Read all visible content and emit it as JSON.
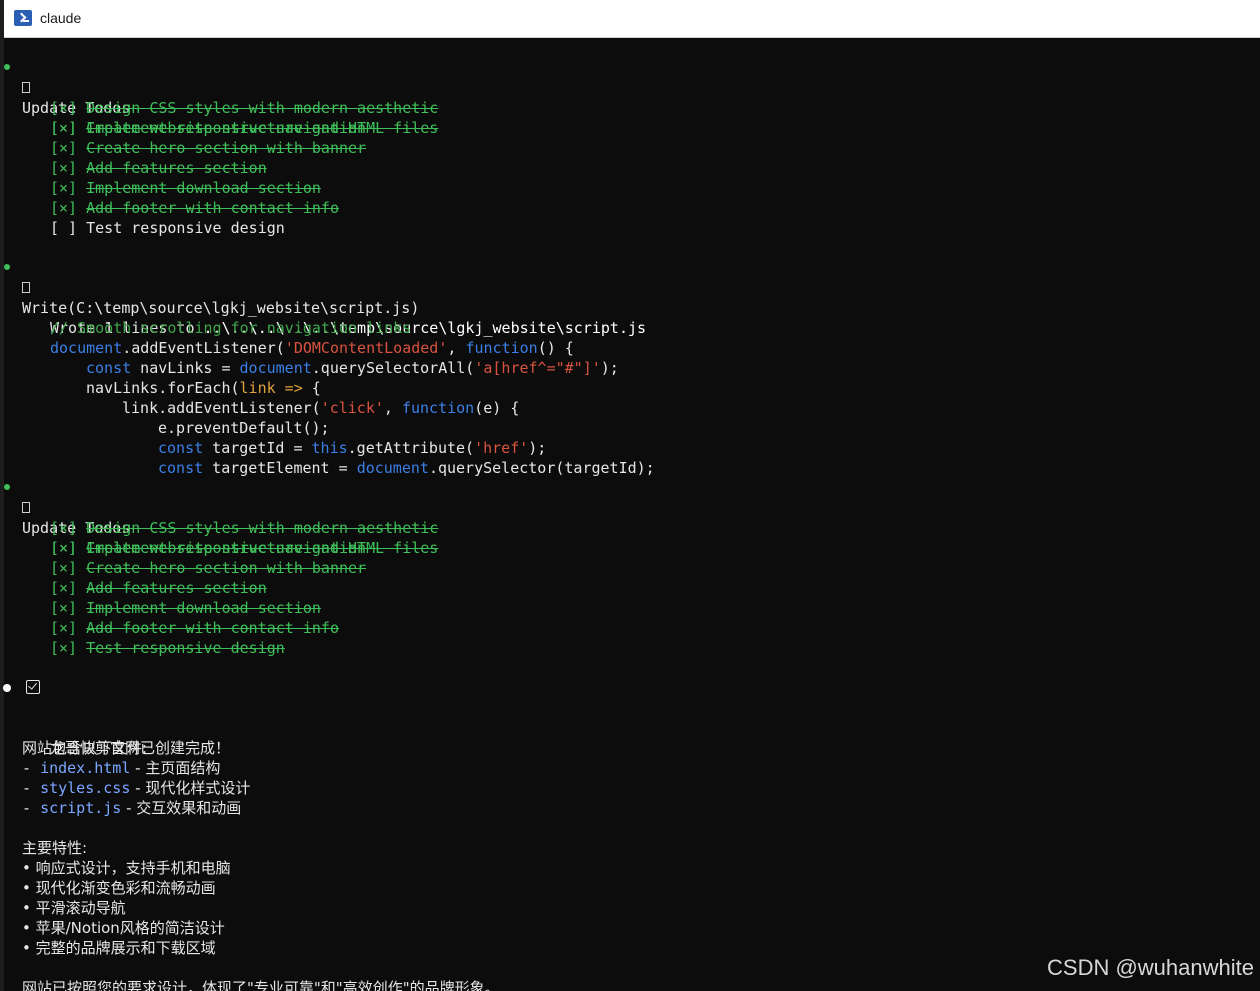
{
  "window": {
    "title": "claude"
  },
  "todos1": {
    "heading": "Update Todos",
    "items": [
      {
        "mark": "[×]",
        "text": "Create website structure and HTML files"
      },
      {
        "mark": "[×]",
        "text": "Design CSS styles with modern aesthetic"
      },
      {
        "mark": "[×]",
        "text": "Implement responsive navigation"
      },
      {
        "mark": "[×]",
        "text": "Create hero section with banner"
      },
      {
        "mark": "[×]",
        "text": "Add features section"
      },
      {
        "mark": "[×]",
        "text": "Implement download section"
      },
      {
        "mark": "[×]",
        "text": "Add footer with contact info"
      },
      {
        "mark": "[ ]",
        "text": "Test responsive design"
      }
    ]
  },
  "write": {
    "heading": "Write(C:\\temp\\source\\lgkj_website\\script.js)",
    "wrote_prefix": "Wrote 1 lines to ",
    "wrote_path": "..\\..\\..\\..\\..\\temp\\source\\lgkj_website\\script.js",
    "code": {
      "comment": "// Smooth scrolling for navigation links",
      "l2_obj": "document",
      "l2_call": ".addEventListener(",
      "l2_str": "'DOMContentLoaded'",
      "l2_sep": ", ",
      "l2_kw": "function",
      "l2_end": "() {",
      "l3_kw": "const",
      "l3_mid": " navLinks = ",
      "l3_obj": "document",
      "l3_call": ".querySelectorAll(",
      "l3_str": "'a[href^=\"#\"]'",
      "l3_end": ");",
      "l4_pre": "navLinks.forEach(",
      "l4_param": "link",
      "l4_arrow": " =>",
      "l4_end": " {",
      "l5_pre": "link.addEventListener(",
      "l5_str": "'click'",
      "l5_sep": ", ",
      "l5_kw": "function",
      "l5_end": "(e) {",
      "l6": "e.preventDefault();",
      "l7_kw": "const",
      "l7_mid": " targetId = ",
      "l7_this": "this",
      "l7_call": ".getAttribute(",
      "l7_str": "'href'",
      "l7_end": ");",
      "l8_kw": "const",
      "l8_mid": " targetElement = ",
      "l8_obj": "document",
      "l8_end": ".querySelector(targetId);"
    }
  },
  "todos2": {
    "heading": "Update Todos",
    "items": [
      {
        "mark": "[×]",
        "text": "Create website structure and HTML files"
      },
      {
        "mark": "[×]",
        "text": "Design CSS styles with modern aesthetic"
      },
      {
        "mark": "[×]",
        "text": "Implement responsive navigation"
      },
      {
        "mark": "[×]",
        "text": "Create hero section with banner"
      },
      {
        "mark": "[×]",
        "text": "Add features section"
      },
      {
        "mark": "[×]",
        "text": "Implement download section"
      },
      {
        "mark": "[×]",
        "text": "Add footer with contact info"
      },
      {
        "mark": "[×]",
        "text": "Test responsive design"
      }
    ]
  },
  "summary": {
    "done_msg": "龙哥快剪官网已创建完成！",
    "files_heading": "网站包含以下文件:",
    "files": [
      {
        "name": "index.html",
        "desc": " - 主页面结构"
      },
      {
        "name": "styles.css",
        "desc": " - 现代化样式设计"
      },
      {
        "name": "script.js",
        "desc": " - 交互效果和动画"
      }
    ],
    "features_heading": "主要特性:",
    "features": [
      "响应式设计，支持手机和电脑",
      "现代化渐变色彩和流畅动画",
      "平滑滚动导航",
      "苹果/Notion风格的简洁设计",
      "完整的品牌展示和下载区域"
    ],
    "closing": "网站已按照您的要求设计，体现了\"专业可靠\"和\"高效创作\"的品牌形象。"
  },
  "watermark": "CSDN @wuhanwhite",
  "colors": {
    "background": "#0c0c0c",
    "done_green": "#3fbf5a",
    "keyword_blue": "#3c7fe6",
    "string_red": "#d9533e",
    "param_orange": "#e1a23a"
  }
}
